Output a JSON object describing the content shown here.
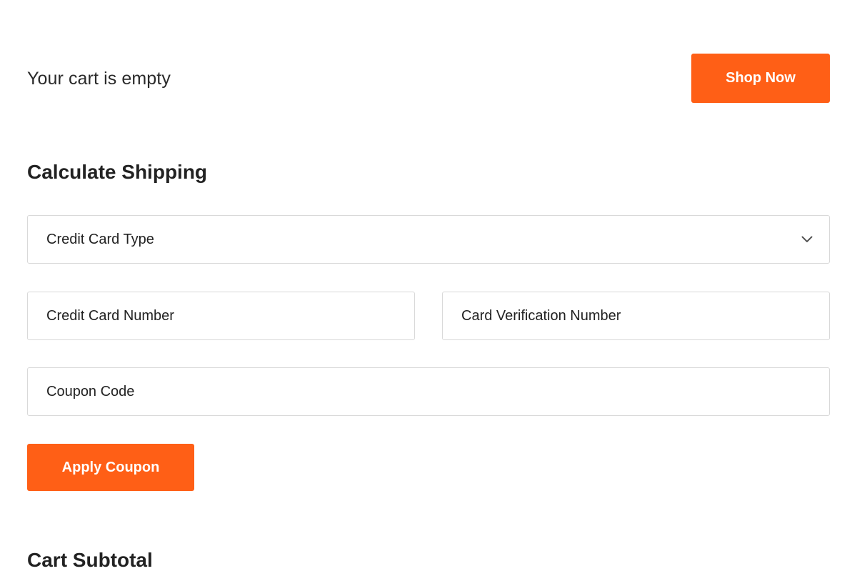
{
  "cart": {
    "empty_message": "Your cart is empty",
    "shop_now_label": "Shop Now"
  },
  "shipping": {
    "heading": "Calculate Shipping",
    "card_type_selected": "Credit Card Type",
    "card_number_placeholder": "Credit Card Number",
    "card_verification_placeholder": "Card Verification Number",
    "coupon_placeholder": "Coupon Code",
    "apply_coupon_label": "Apply Coupon"
  },
  "subtotal": {
    "heading": "Cart Subtotal"
  },
  "icons": {
    "select_arrow": "chevron-down-icon"
  },
  "colors": {
    "accent": "#ff5f16",
    "border": "#d9d9d9",
    "text": "#222222"
  }
}
